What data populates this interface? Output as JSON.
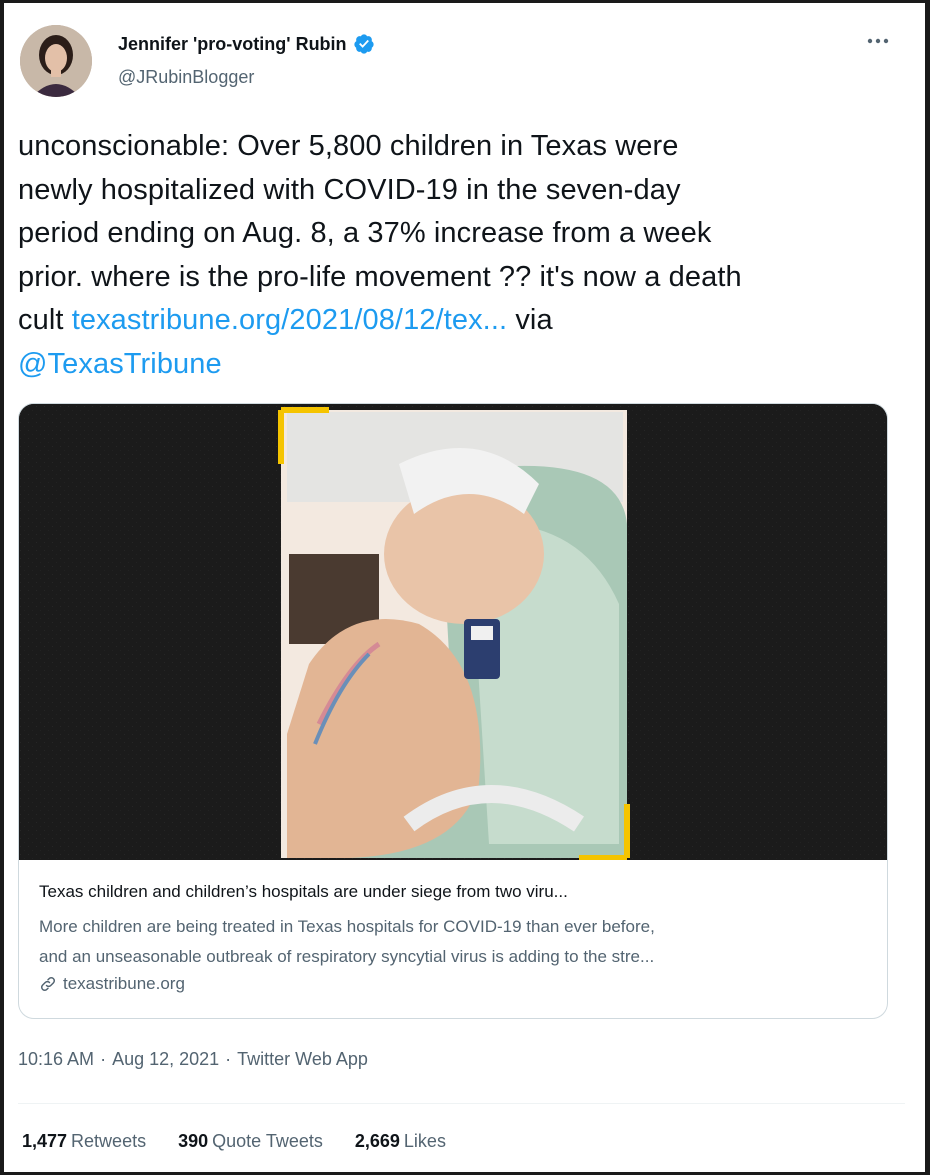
{
  "author": {
    "name": "Jennifer 'pro-voting' Rubin",
    "handle": "@JRubinBlogger"
  },
  "tweet": {
    "text_lines": [
      "unconscionable: Over 5,800 children in Texas were",
      "newly hospitalized with COVID-19 in the seven-day",
      "period ending on Aug. 8,  a 37% increase from a week",
      "prior. where is the pro-life movement ?? it's now a death"
    ],
    "last_prefix": "cult ",
    "url": "texastribune.org/2021/08/12/tex...",
    "via": " via",
    "mention": "@TexasTribune"
  },
  "card": {
    "title": "Texas children and children’s hospitals are under siege from two viru...",
    "description_lines": [
      "More children are being treated in Texas hospitals for COVID-19 than ever before,",
      "and an unseasonable outbreak of respiratory syncytial virus is adding to the stre..."
    ],
    "domain": "texastribune.org"
  },
  "meta": {
    "time": "10:16 AM",
    "sep1": "·",
    "date": "Aug 12, 2021",
    "sep2": "·",
    "source": "Twitter Web App"
  },
  "stats": {
    "retweets_count": "1,477",
    "retweets_label": "Retweets",
    "quotes_count": "390",
    "quotes_label": "Quote Tweets",
    "likes_count": "2,669",
    "likes_label": "Likes"
  },
  "colors": {
    "accent": "#1d9bf0",
    "verified": "#1d9bf0"
  }
}
